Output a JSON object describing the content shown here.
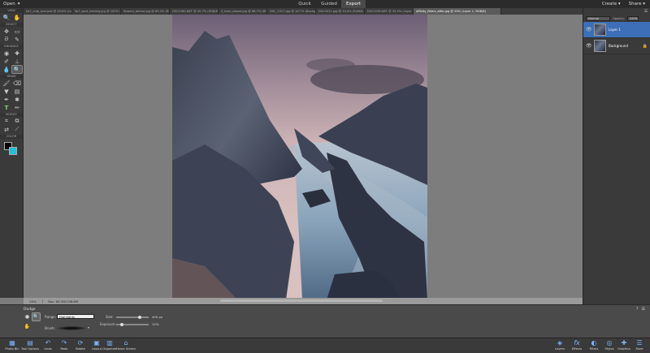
{
  "menu": {
    "open_label": "Open",
    "open_arrow": "▾"
  },
  "modes": [
    {
      "label": "Quick",
      "active": false
    },
    {
      "label": "Guided",
      "active": false
    },
    {
      "label": "Export",
      "active": true
    }
  ],
  "right_menu": {
    "create": "Create ▾",
    "share": "Share ▾"
  },
  "tabs": [
    "lip7_crop_tool.psd @ 16.6% (Layer...",
    "lip7_spot_healing.jpg @ 100% (RGB/8...",
    "flowers_before.jpg @ 65.4% (RGB/8...",
    "DSC5180.NEF @ 20.7% (RGB/8...",
    "3_from_above.jpg @ 66.7% (RGB/8...",
    "DSC_2317.jpg @ 16.7% (Background...",
    "DSC4411.jpg @ 33.4% (RGB/8...",
    "DSC5228.NEF @ 33.3% (Layer 0...",
    "affinity_filters_after.jpg @ 25% (Layer 1, RGB/8)"
  ],
  "active_tab_index": 8,
  "toolbar": {
    "sections": [
      "VIEW",
      "SELECT",
      "ENHANCE",
      "DRAW",
      "MODIFY",
      "COLOR"
    ],
    "colors": {
      "foreground": "#000000",
      "background": "#1ec2d9"
    }
  },
  "status": {
    "zoom": "25%",
    "doc": "Doc: 69.3M/138.6M"
  },
  "layers_panel": {
    "blend_mode": "Normal",
    "opacity_label": "Opacity:",
    "opacity_value": "100%",
    "layers": [
      {
        "name": "Layer 1",
        "active": true
      },
      {
        "name": "Background",
        "active": false
      }
    ]
  },
  "tool_options": {
    "tool_name": "Dodge",
    "range_label": "Range:",
    "range_value": "Highlights",
    "brush_label": "Brush:",
    "size_label": "Size:",
    "size_value": "400 px",
    "size_level": 0.75,
    "exposure_label": "Exposure:",
    "exposure_value": "15%",
    "exposure_level": 0.15
  },
  "taskbar": {
    "left": [
      {
        "label": "Photo Bin",
        "icon": "photo-bin-icon"
      },
      {
        "label": "Tool Options",
        "icon": "tool-options-icon"
      },
      {
        "label": "Undo",
        "icon": "undo-icon"
      },
      {
        "label": "Redo",
        "icon": "redo-icon"
      },
      {
        "label": "Rotate",
        "icon": "rotate-icon"
      },
      {
        "label": "Layout",
        "icon": "layout-icon"
      },
      {
        "label": "Organizer",
        "icon": "organizer-icon"
      },
      {
        "label": "Home Screen",
        "icon": "home-screen-icon"
      }
    ],
    "right": [
      {
        "label": "Layers",
        "icon": "layers-icon"
      },
      {
        "label": "Effects",
        "icon": "effects-icon"
      },
      {
        "label": "Filters",
        "icon": "filters-icon"
      },
      {
        "label": "Styles",
        "icon": "styles-icon"
      },
      {
        "label": "Graphics",
        "icon": "graphics-icon"
      },
      {
        "label": "More",
        "icon": "more-icon"
      }
    ]
  }
}
